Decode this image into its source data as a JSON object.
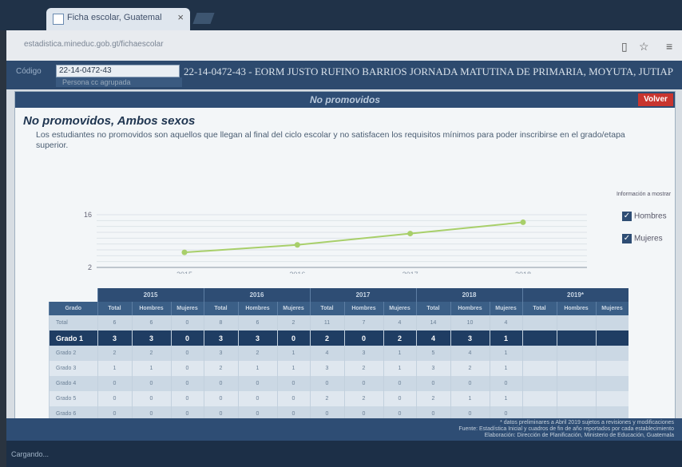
{
  "browser": {
    "tab_title": "Ficha escolar, Guatemal",
    "url": "estadistica.mineduc.gob.gt/fichaescolar"
  },
  "codebar": {
    "label": "Código",
    "selected_code": "22-14-0472-43",
    "second_option": "Persona cc agrupada",
    "school_name": "22-14-0472-43 - EORM JUSTO RUFINO BARRIOS JORNADA MATUTINA DE PRIMARIA, MOYUTA, JUTIAP"
  },
  "panel": {
    "header": "No promovidos",
    "back_button": "Volver",
    "title": "No promovidos, Ambos sexos",
    "description": "Los estudiantes no promovidos son aquellos que llegan al final del ciclo escolar y no satisfacen los requisitos mínimos para poder inscribirse en el grado/etapa superior."
  },
  "legend": {
    "title": "Información a mostrar",
    "items": [
      {
        "label": "Hombres",
        "checked": true
      },
      {
        "label": "Mujeres",
        "checked": true
      }
    ]
  },
  "chart_data": {
    "type": "line",
    "x": [
      "2015",
      "2016",
      "2017",
      "2018"
    ],
    "series": [
      {
        "values": [
          6,
          8,
          11,
          14
        ]
      }
    ],
    "ylim": [
      2,
      16
    ],
    "ytick_labels": [
      "16",
      "2"
    ],
    "grid": true,
    "line_color": "#a8cf6a"
  },
  "table": {
    "years": [
      "2015",
      "2016",
      "2017",
      "2018",
      "2019*"
    ],
    "grade_header": "Grado",
    "sub_headers": [
      "Total",
      "Hombres",
      "Mujeres"
    ],
    "rows": [
      {
        "grade": "Total",
        "values": [
          "6",
          "6",
          "0",
          "8",
          "6",
          "2",
          "11",
          "7",
          "4",
          "14",
          "10",
          "4",
          "",
          "",
          ""
        ]
      },
      {
        "grade": "Grado 1",
        "values": [
          "3",
          "3",
          "0",
          "3",
          "3",
          "0",
          "2",
          "0",
          "2",
          "4",
          "3",
          "1",
          "",
          "",
          ""
        ],
        "highlight": true
      },
      {
        "grade": "Grado 2",
        "values": [
          "2",
          "2",
          "0",
          "3",
          "2",
          "1",
          "4",
          "3",
          "1",
          "5",
          "4",
          "1",
          "",
          "",
          ""
        ]
      },
      {
        "grade": "Grado 3",
        "values": [
          "1",
          "1",
          "0",
          "2",
          "1",
          "1",
          "3",
          "2",
          "1",
          "3",
          "2",
          "1",
          "",
          "",
          ""
        ]
      },
      {
        "grade": "Grado 4",
        "values": [
          "0",
          "0",
          "0",
          "0",
          "0",
          "0",
          "0",
          "0",
          "0",
          "0",
          "0",
          "0",
          "",
          "",
          ""
        ]
      },
      {
        "grade": "Grado 5",
        "values": [
          "0",
          "0",
          "0",
          "0",
          "0",
          "0",
          "2",
          "2",
          "0",
          "2",
          "1",
          "1",
          "",
          "",
          ""
        ]
      },
      {
        "grade": "Grado 6",
        "values": [
          "0",
          "0",
          "0",
          "0",
          "0",
          "0",
          "0",
          "0",
          "0",
          "0",
          "0",
          "0",
          "",
          "",
          ""
        ]
      }
    ]
  },
  "footer": {
    "note": "* datos preliminares a Abril 2019 sujetos a revisiones y modificaciones",
    "source": "Fuente: Estadística Inicial y cuadros de fin de año reportados por cada establecimiento",
    "elaboration": "Elaboración: Dirección de Planificación, Ministerio de Educación, Guatemala"
  },
  "status_text": "Cargando..."
}
